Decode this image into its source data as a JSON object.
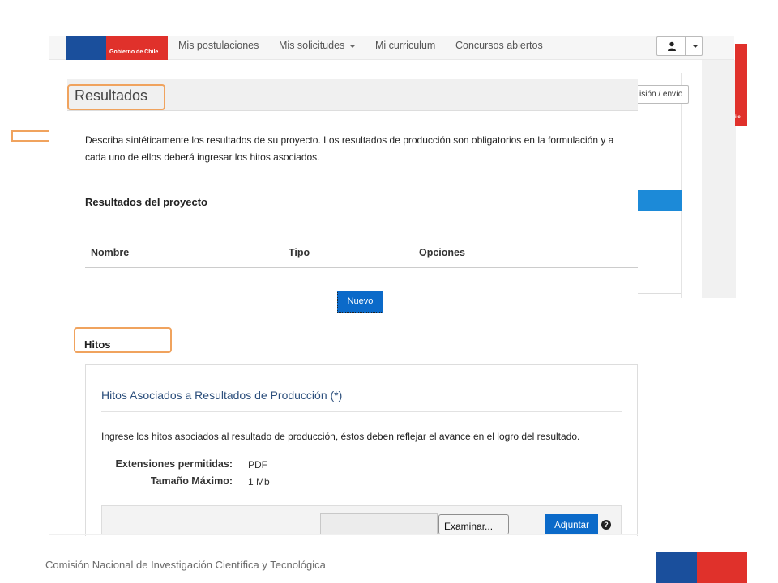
{
  "navbar": {
    "logo_text": "Gobierno de Chile",
    "items": [
      {
        "label": "Mis postulaciones"
      },
      {
        "label": "Mis solicitudes"
      },
      {
        "label": "Mi curriculum"
      },
      {
        "label": "Concursos abiertos"
      }
    ],
    "user_icon": "user-icon"
  },
  "background": {
    "revision_button": "isión / envío",
    "right_logo_text": "ile"
  },
  "resultados": {
    "title": "Resultados",
    "description": "Describa sintéticamente los resultados de su proyecto. Los resultados de producción son obligatorios en la formulación y a cada uno de ellos deberá ingresar los hitos asociados.",
    "section_title": "Resultados del proyecto",
    "table_headers": [
      "Nombre",
      "Tipo",
      "Opciones"
    ],
    "new_button": "Nuevo"
  },
  "hitos": {
    "title": "Hitos",
    "card_title": "Hitos Asociados a Resultados de Producción (*)",
    "description": "Ingrese los hitos asociados al resultado de producción, éstos deben reflejar el avance en el logro del resultado.",
    "extensions_label": "Extensiones permitidas:",
    "extensions_value": "PDF",
    "max_size_label": "Tamaño Máximo:",
    "max_size_value": "1 Mb",
    "browse_button": "Examinar...",
    "attach_button": "Adjuntar",
    "help_symbol": "?"
  },
  "footer": {
    "text": "Comisión Nacional de Investigación Científica y Tecnológica"
  },
  "colors": {
    "accent_blue": "#0b6ac9",
    "gob_blue": "#1a4f9c",
    "gob_red": "#e0312b",
    "highlight": "#f0a35e"
  }
}
